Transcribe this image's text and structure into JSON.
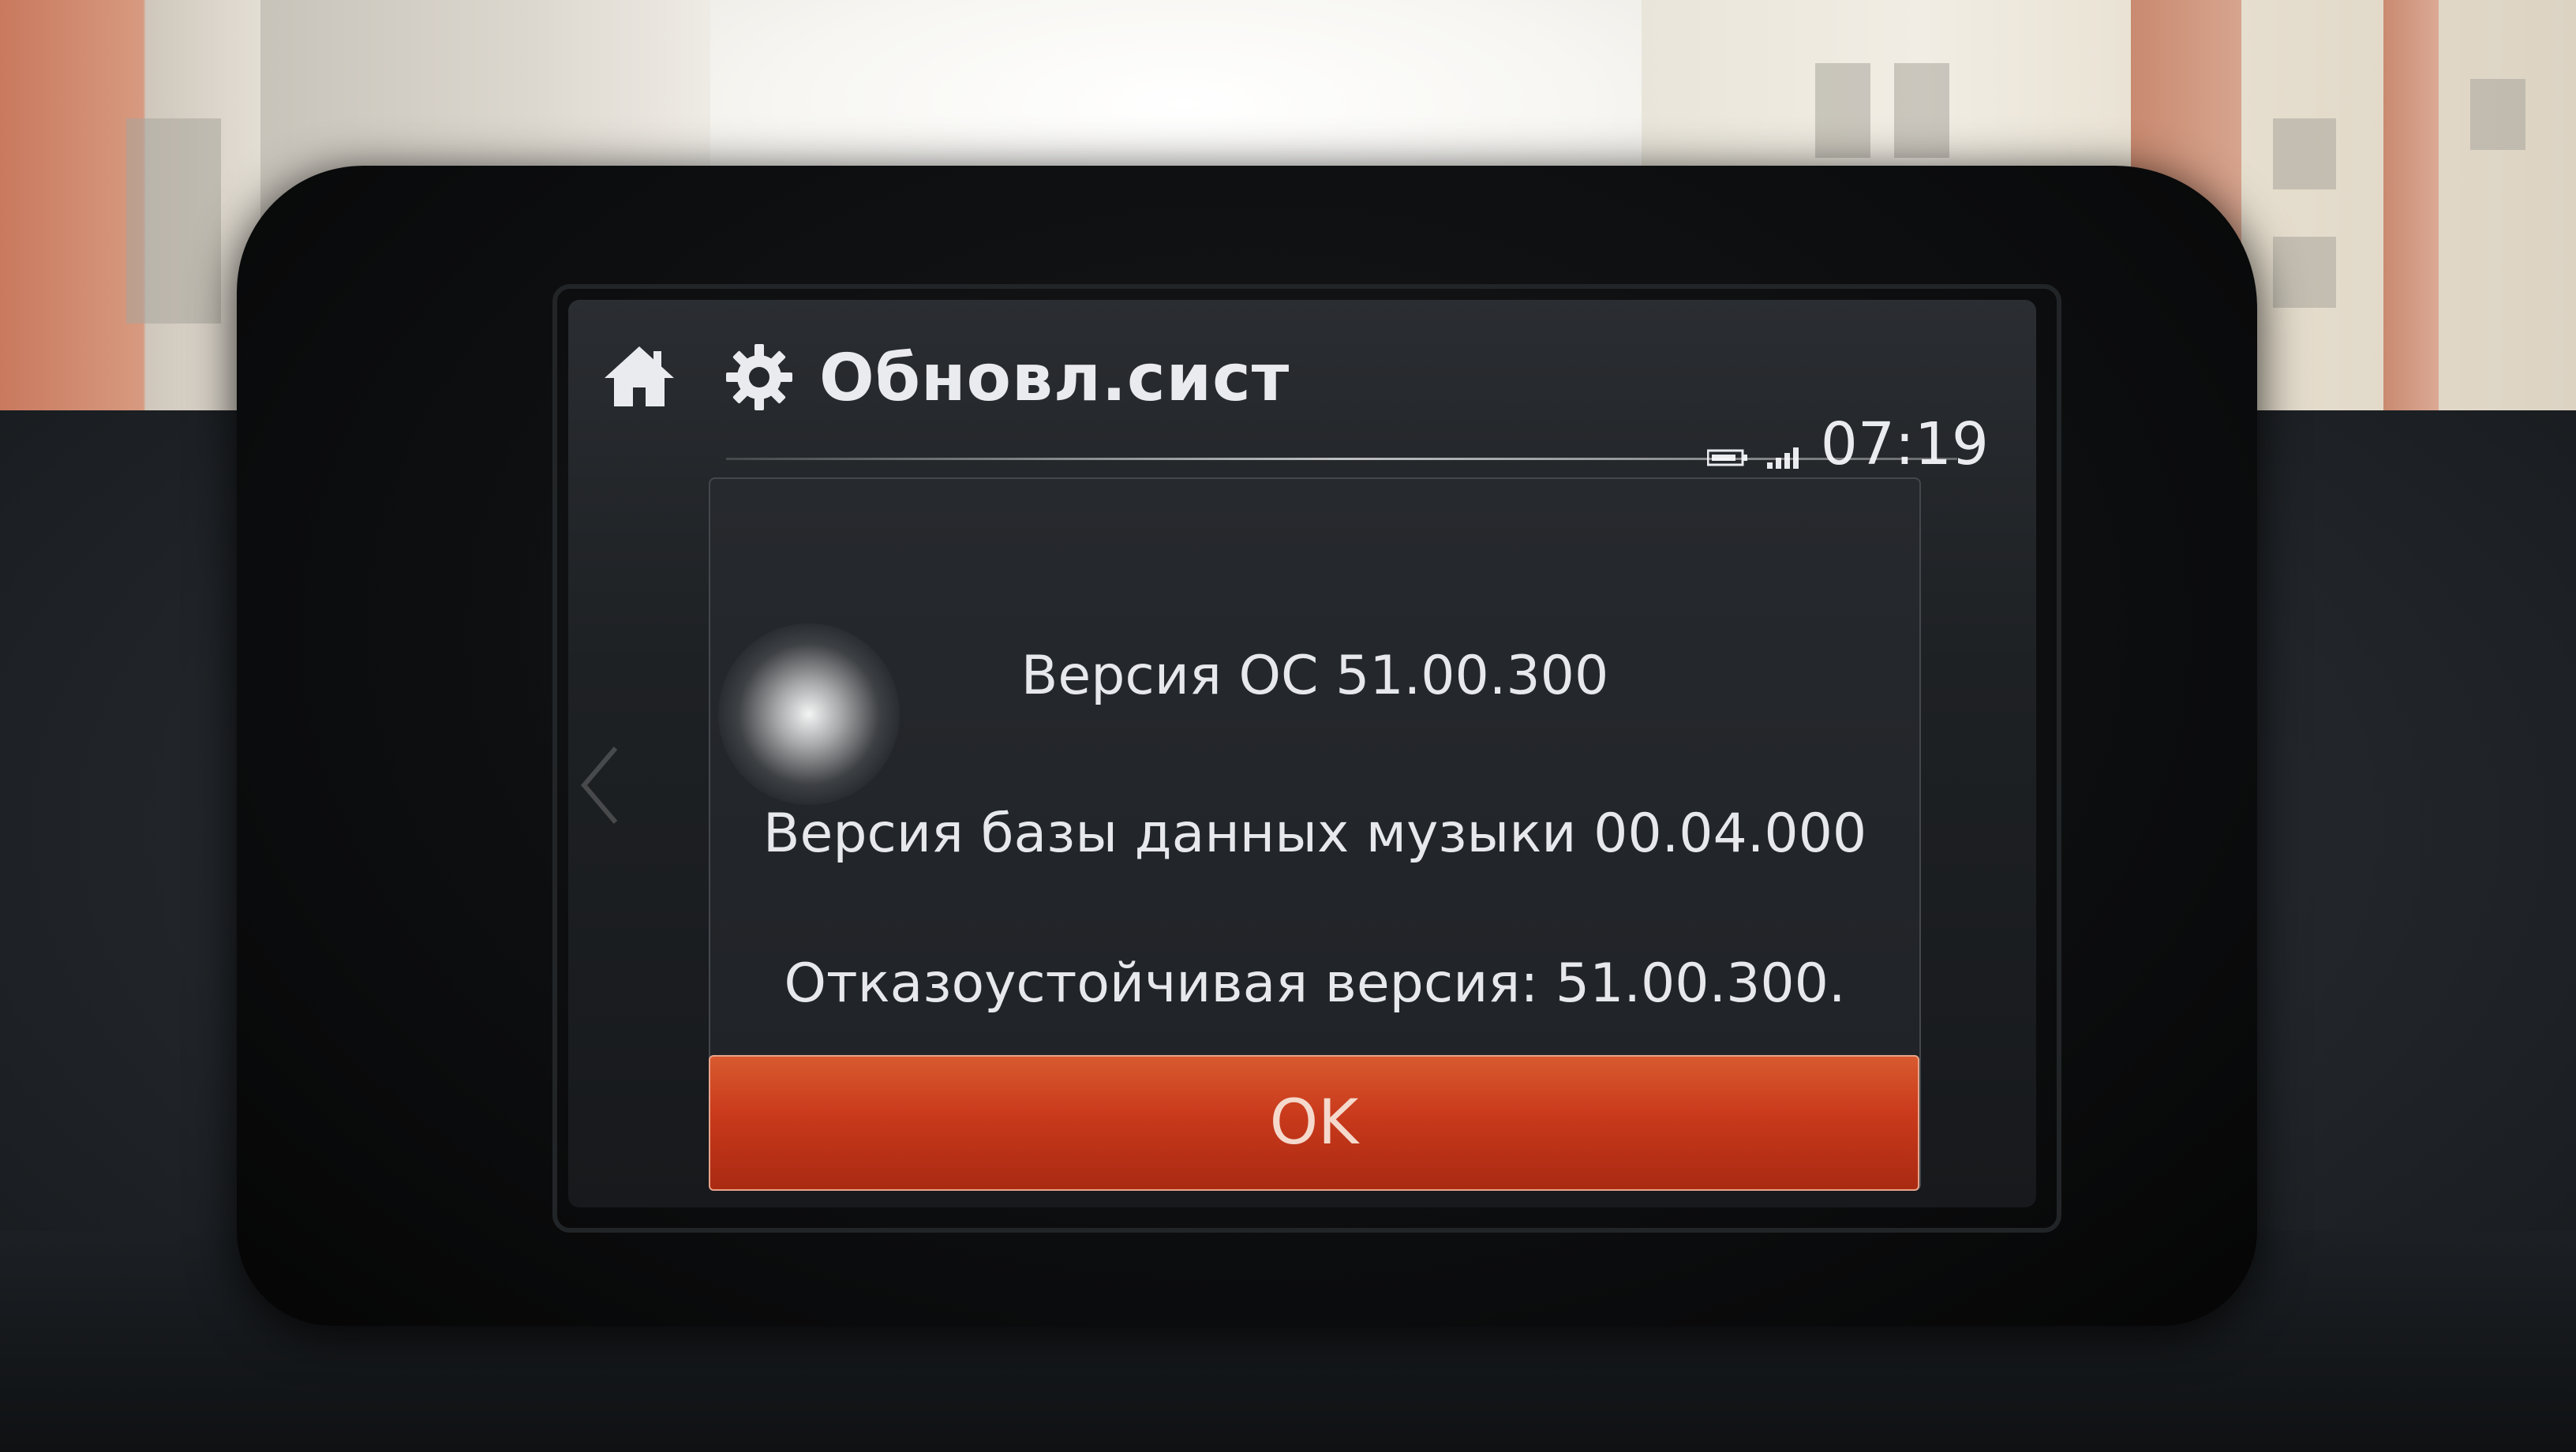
{
  "header": {
    "title": "Обновл.сист",
    "time": "07:19",
    "icons": {
      "home": "home-icon",
      "settings": "gear-icon",
      "battery": "battery-icon",
      "signal": "signal-icon"
    }
  },
  "dialog": {
    "lines": [
      "Версия ОС 51.00.300",
      "Версия базы данных музыки 00.04.000",
      "Отказоустойчивая версия: 51.00.300."
    ],
    "ok_label": "OK"
  },
  "colors": {
    "accent": "#c9391b",
    "text": "#e6e8eb",
    "screen_bg": "#1f2226"
  }
}
